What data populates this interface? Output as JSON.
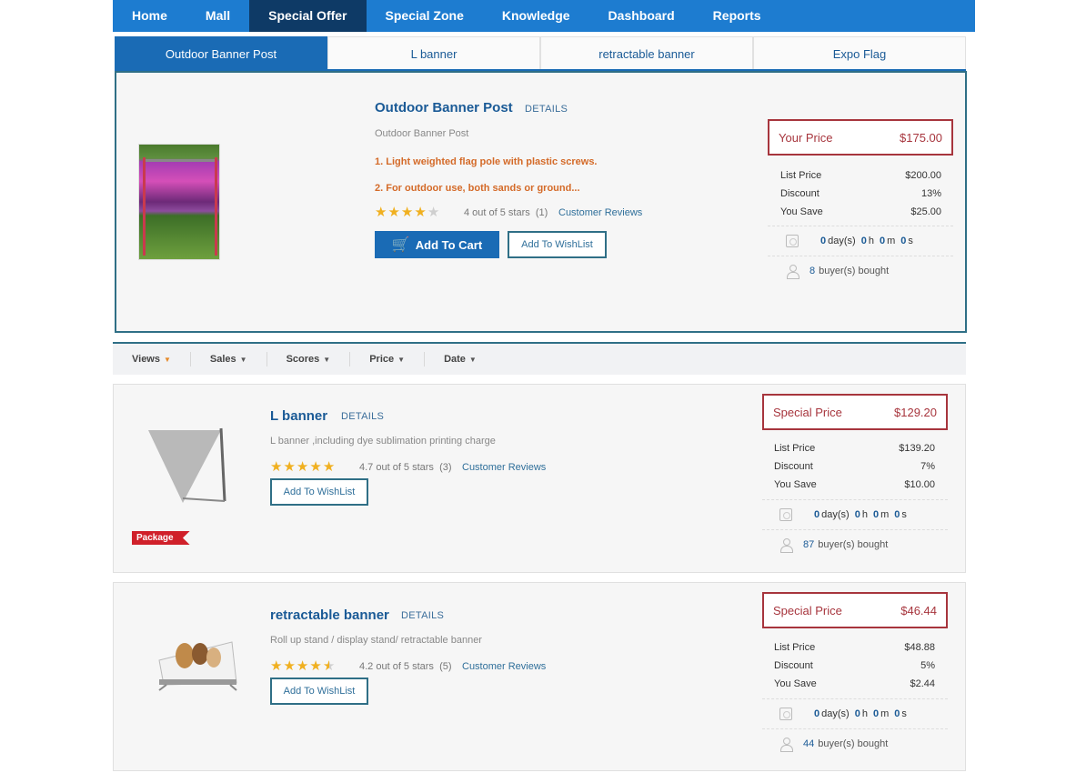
{
  "nav": [
    "Home",
    "Mall",
    "Special Offer",
    "Special Zone",
    "Knowledge",
    "Dashboard",
    "Reports"
  ],
  "nav_active": "Special Offer",
  "tabs": [
    "Outdoor Banner Post",
    "L banner",
    "retractable banner",
    "Expo Flag"
  ],
  "featured": {
    "title": "Outdoor Banner Post",
    "details": "DETAILS",
    "desc": "Outdoor Banner Post",
    "feature1": "1. Light weighted flag pole with plastic screws.",
    "feature2": "2. For outdoor use, both sands or ground...",
    "stars": 4,
    "rating_text": "4 out of 5 stars",
    "review_count": "(1)",
    "reviews_link": "Customer Reviews",
    "cart_label": "Add To Cart",
    "wish_label": "Add To WishList",
    "price_label": "Your Price",
    "price": "$175.00",
    "list_price_label": "List Price",
    "list_price": "$200.00",
    "discount_label": "Discount",
    "discount": "13%",
    "save_label": "You Save",
    "save": "$25.00",
    "timer": {
      "days": "0",
      "days_unit": "day(s)",
      "h": "0",
      "h_unit": "h",
      "m": "0",
      "m_unit": "m",
      "s": "0",
      "s_unit": "s"
    },
    "bought_count": "8",
    "bought_label": "buyer(s) bought"
  },
  "sort": [
    {
      "label": "Views",
      "active": true
    },
    {
      "label": "Sales",
      "active": false
    },
    {
      "label": "Scores",
      "active": false
    },
    {
      "label": "Price",
      "active": false
    },
    {
      "label": "Date",
      "active": false
    }
  ],
  "products": [
    {
      "title": "L banner",
      "details": "DETAILS",
      "desc": "L banner ,including dye sublimation printing charge",
      "stars": 5,
      "rating_text": "4.7 out of 5 stars",
      "review_count": "(3)",
      "reviews_link": "Customer Reviews",
      "wish_label": "Add To WishList",
      "badge": "Package",
      "price_label": "Special Price",
      "price": "$129.20",
      "list_price_label": "List Price",
      "list_price": "$139.20",
      "discount_label": "Discount",
      "discount": "7%",
      "save_label": "You Save",
      "save": "$10.00",
      "timer": {
        "days": "0",
        "days_unit": "day(s)",
        "h": "0",
        "h_unit": "h",
        "m": "0",
        "m_unit": "m",
        "s": "0",
        "s_unit": "s"
      },
      "bought_count": "87",
      "bought_label": "buyer(s) bought"
    },
    {
      "title": "retractable banner",
      "details": "DETAILS",
      "desc": "Roll up stand / display stand/ retractable banner",
      "stars": 4.5,
      "rating_text": "4.2 out of 5 stars",
      "review_count": "(5)",
      "reviews_link": "Customer Reviews",
      "wish_label": "Add To WishList",
      "price_label": "Special Price",
      "price": "$46.44",
      "list_price_label": "List Price",
      "list_price": "$48.88",
      "discount_label": "Discount",
      "discount": "5%",
      "save_label": "You Save",
      "save": "$2.44",
      "timer": {
        "days": "0",
        "days_unit": "day(s)",
        "h": "0",
        "h_unit": "h",
        "m": "0",
        "m_unit": "m",
        "s": "0",
        "s_unit": "s"
      },
      "bought_count": "44",
      "bought_label": "buyer(s) bought"
    }
  ],
  "colors": {
    "nav_bg": "#1d7cd0",
    "nav_active": "#0e3a66",
    "accent": "#1a6bb5",
    "price_red": "#a7353d",
    "star": "#f0b020",
    "feature_orange": "#d46a28",
    "badge_red": "#d0202a"
  }
}
